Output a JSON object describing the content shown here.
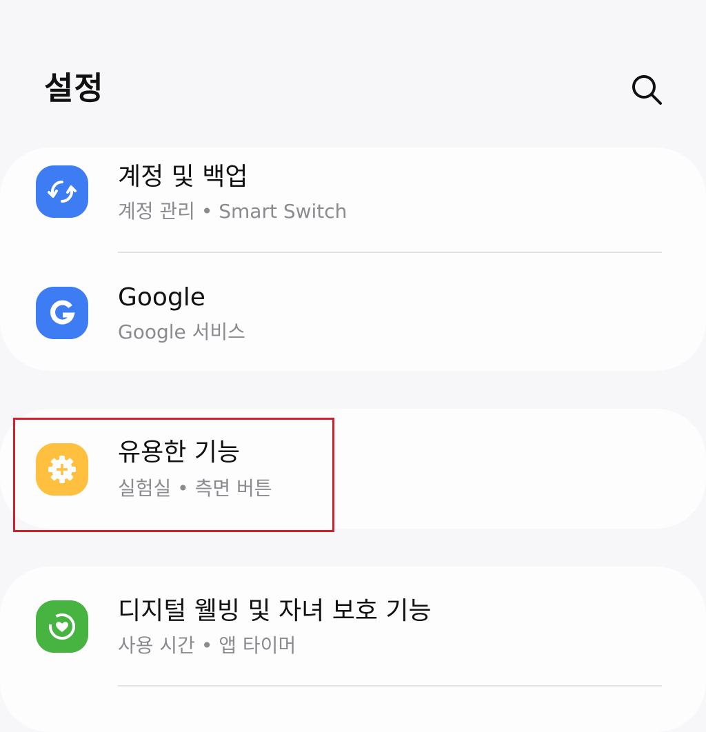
{
  "header": {
    "title": "설정",
    "search_icon": "search-icon"
  },
  "items": [
    {
      "title": "계정 및 백업",
      "subtitle": "계정 관리  •  Smart Switch",
      "icon": "sync-icon",
      "icon_color": "#3d7cf2"
    },
    {
      "title": "Google",
      "subtitle": "Google 서비스",
      "icon": "google-g-icon",
      "icon_color": "#3d7cf2"
    },
    {
      "title": "유용한 기능",
      "subtitle": "실험실  •  측면 버튼",
      "icon": "gear-plus-icon",
      "icon_color": "#ffbf3f"
    },
    {
      "title": "디지털 웰빙 및 자녀 보호 기능",
      "subtitle": "사용 시간  •  앱 타이머",
      "icon": "heart-ring-icon",
      "icon_color": "#47b341"
    }
  ],
  "highlight_color": "#d2202c"
}
